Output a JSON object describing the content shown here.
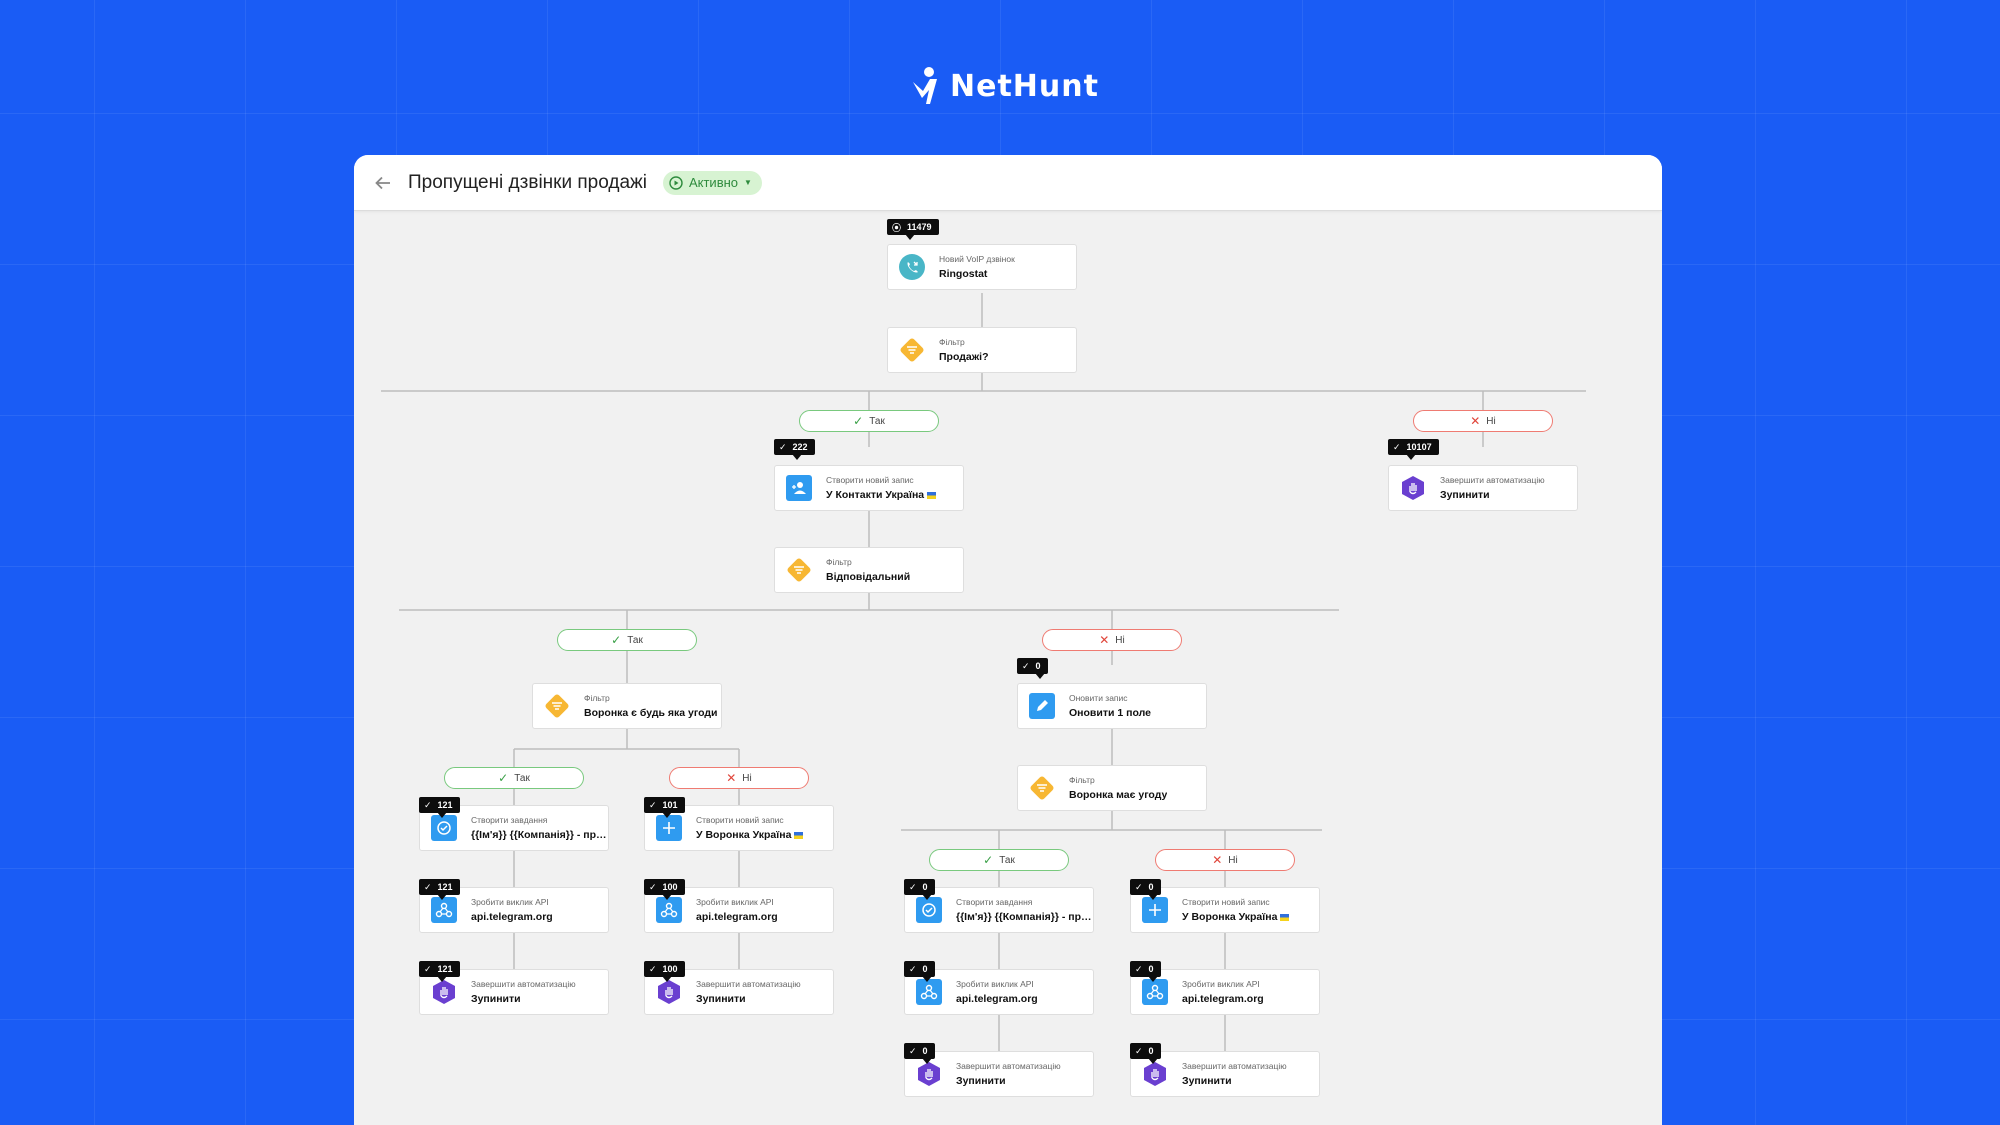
{
  "brand": {
    "name": "NetHunt"
  },
  "header": {
    "title": "Пропущені дзвінки продажі",
    "status": "Активно"
  },
  "colors": {
    "background": "#1a5cf5",
    "filter": "#f7b733",
    "action": "#2f9bf0",
    "trigger": "#49b6c7",
    "stop": "#6a3fd0",
    "yes_border": "#79c97e",
    "no_border": "#ef7b72"
  },
  "branches": {
    "yes": "Так",
    "no": "Ні"
  },
  "nodes": [
    {
      "id": "n1",
      "icon": "phone-icon",
      "label": "Новий VoIP дзвінок",
      "value": "Ringostat"
    },
    {
      "id": "n2",
      "icon": "filter-icon",
      "label": "Фільтр",
      "value": "Продажі?"
    },
    {
      "id": "n3",
      "icon": "add-contact-icon",
      "label": "Створити новий запис",
      "value": "У Контакти Україна"
    },
    {
      "id": "n4",
      "icon": "stop-hand-icon",
      "label": "Завершити автоматизацію",
      "value": "Зупинити"
    },
    {
      "id": "n5",
      "icon": "filter-icon",
      "label": "Фільтр",
      "value": "Відповідальний"
    },
    {
      "id": "n6",
      "icon": "filter-icon",
      "label": "Фільтр",
      "value": "Воронка є будь яка угоди"
    },
    {
      "id": "n7",
      "icon": "edit-icon",
      "label": "Оновити запис",
      "value": "Оновити 1 поле"
    },
    {
      "id": "n8",
      "icon": "filter-icon",
      "label": "Фільтр",
      "value": "Воронка має угоду"
    },
    {
      "id": "n9",
      "icon": "task-check-icon",
      "label": "Створити завдання",
      "value": "{{Ім'я}} {{Компанія}} - пропущений дзвінок"
    },
    {
      "id": "n10",
      "icon": "plus-icon",
      "label": "Створити новий запис",
      "value": "У Воронка Україна"
    },
    {
      "id": "n11",
      "icon": "webhook-icon",
      "label": "Зробити виклик API",
      "value": "api.telegram.org"
    },
    {
      "id": "n12",
      "icon": "webhook-icon",
      "label": "Зробити виклик API",
      "value": "api.telegram.org"
    },
    {
      "id": "n13",
      "icon": "stop-hand-icon",
      "label": "Завершити автоматизацію",
      "value": "Зупинити"
    },
    {
      "id": "n14",
      "icon": "stop-hand-icon",
      "label": "Завершити автоматизацію",
      "value": "Зупинити"
    },
    {
      "id": "n15",
      "icon": "task-check-icon",
      "label": "Створити завдання",
      "value": "{{Ім'я}} {{Компанія}} - пропущений дзвінок"
    },
    {
      "id": "n16",
      "icon": "plus-icon",
      "label": "Створити новий запис",
      "value": "У Воронка Україна"
    },
    {
      "id": "n17",
      "icon": "webhook-icon",
      "label": "Зробити виклик API",
      "value": "api.telegram.org"
    },
    {
      "id": "n18",
      "icon": "webhook-icon",
      "label": "Зробити виклик API",
      "value": "api.telegram.org"
    },
    {
      "id": "n19",
      "icon": "stop-hand-icon",
      "label": "Завершити автоматизацію",
      "value": "Зупинити"
    },
    {
      "id": "n20",
      "icon": "stop-hand-icon",
      "label": "Завершити автоматизацію",
      "value": "Зупинити"
    }
  ],
  "counters": [
    {
      "id": "c1",
      "kind": "play",
      "value": "11479"
    },
    {
      "id": "c3",
      "kind": "check",
      "value": "222"
    },
    {
      "id": "c4",
      "kind": "check",
      "value": "10107"
    },
    {
      "id": "c7",
      "kind": "check",
      "value": "0"
    },
    {
      "id": "c9",
      "kind": "check",
      "value": "121"
    },
    {
      "id": "c10",
      "kind": "check",
      "value": "101"
    },
    {
      "id": "c11",
      "kind": "check",
      "value": "121"
    },
    {
      "id": "c12",
      "kind": "check",
      "value": "100"
    },
    {
      "id": "c13",
      "kind": "check",
      "value": "121"
    },
    {
      "id": "c14",
      "kind": "check",
      "value": "100"
    },
    {
      "id": "c15",
      "kind": "check",
      "value": "0"
    },
    {
      "id": "c16",
      "kind": "check",
      "value": "0"
    },
    {
      "id": "c17",
      "kind": "check",
      "value": "0"
    },
    {
      "id": "c18",
      "kind": "check",
      "value": "0"
    },
    {
      "id": "c19",
      "kind": "check",
      "value": "0"
    },
    {
      "id": "c20",
      "kind": "check",
      "value": "0"
    }
  ]
}
